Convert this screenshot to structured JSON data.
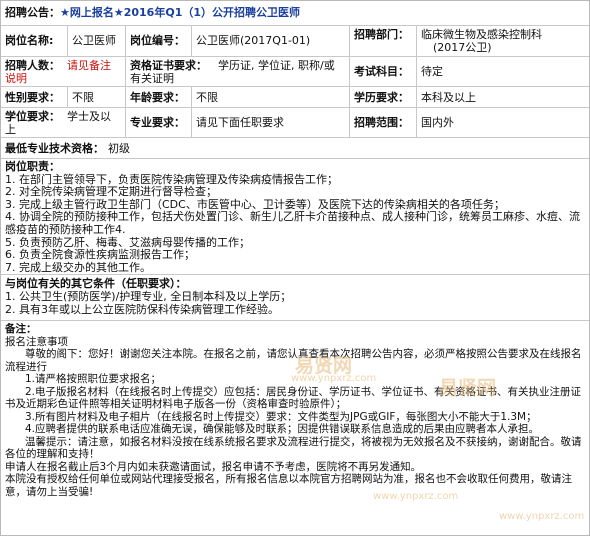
{
  "header": {
    "label": "招聘公告：",
    "title": "★网上报名★2016年Q1（1）公开招聘公卫医师"
  },
  "row1": {
    "post_name_label": "岗位名称:",
    "post_name_value": "公卫医师",
    "post_code_label": "岗位编号：",
    "post_code_value": "公卫医师(2017Q1-01)",
    "dept_label": "招聘部门：",
    "dept_value_line1": "临床微生物及感染控制科",
    "dept_value_line2": "(2017公卫)"
  },
  "row2": {
    "count_label": "招聘人数：",
    "count_value_line1": "请见备注",
    "count_value_line2": "说明",
    "cert_label": "资格证书要求：",
    "cert_value_line1": "学历证, 学位证, 职称/或",
    "cert_value_line2": "有关证明",
    "exam_label": "考试科目：",
    "exam_value": "待定"
  },
  "row3": {
    "gender_label": "性别要求：",
    "gender_value": "不限",
    "age_label": "年龄要求：",
    "age_value": "不限",
    "edu_label": "学历要求：",
    "edu_value": "本科及以上"
  },
  "row4": {
    "degree_label": "学位要求：",
    "degree_value_line1": "学士及以",
    "degree_value_line2": "上",
    "major_label": "专业要求：",
    "major_value": "请见下面任职要求",
    "scope_label": "招聘范围：",
    "scope_value": "国内外"
  },
  "row5": {
    "tech_label": "最低专业技术资格：",
    "tech_value": "初级"
  },
  "duties": {
    "title": "岗位职责：",
    "items": [
      "1. 在部门主管领导下，负责医院传染病管理及传染病疫情报告工作；",
      "2. 对全院传染病管理不定期进行督导检查；",
      "3. 完成上级主管行政卫生部门（CDC、市医管中心、卫计委等）及医院下达的传染病相关的各项任务；",
      "4. 协调全院的预防接种工作，包括犬伤处置门诊、新生儿乙肝卡介苗接种点、成人接种门诊，统筹员工麻疹、水痘、流感疫苗的预防接种工作4.",
      "5. 负责预防乙肝、梅毒、艾滋病母婴传播的工作；",
      "6. 负责全院食源性疾病监测报告工作；",
      "7. 完成上级交办的其他工作。"
    ]
  },
  "conditions": {
    "title": "与岗位有关的其它条件（任职要求）：",
    "items": [
      "1. 公共卫生(预防医学)/护理专业, 全日制本科及以上学历；",
      "2. 具有3年或以上公立医院防保科传染病管理工作经验。"
    ]
  },
  "notes": {
    "title": "备注：",
    "heading": "报名注意事项",
    "p1": "尊敬的阁下：您好！谢谢您关注本院。在报名之前，请您认真查看本次招聘公告内容，必须严格按照公告要求及在线报名流程进行",
    "p2": "1.请严格按照职位要求报名；",
    "p3": "2.电子版报名材料（在线报名时上传提交）应包括：居民身份证、学历证书、学位证书、有关资格证书、有关执业注册证书及近期彩色证件照等相关证明材料电子版各一份（资格审查时验原件）；",
    "p4": "3.所有图片材料及电子相片（在线报名时上传提交）要求：文件类型为JPG或GIF，每张图大小不能大于1.3M；",
    "p5": "4.应聘者提供的联系电话应准确无误，确保能够及时联系；因提供错误联系信息造成的后果由应聘者本人承担。",
    "p6": "温馨提示：请注意，如报名材料没按在线系统报名要求及流程进行提交，将被视为无效报名及不获接纳，谢谢配合。敬请各位的理解和支持！",
    "p7": "申请人在报名截止后3个月内如未获邀请面试，报名申请不予考虑，医院将不再另发通知。",
    "p8": "本院没有授权给任何单位或网站代理接受报名，所有报名信息以本院官方招聘网站为准，报名也不会收取任何费用，敬请注意，请勿上当受骗!"
  },
  "watermark": {
    "text1": "易贤网",
    "text2": "易贤网",
    "text3": "www.ynpxrz.com",
    "text4": "www.ynpxrz.com",
    "text5": "www.ynpxrz.com"
  }
}
